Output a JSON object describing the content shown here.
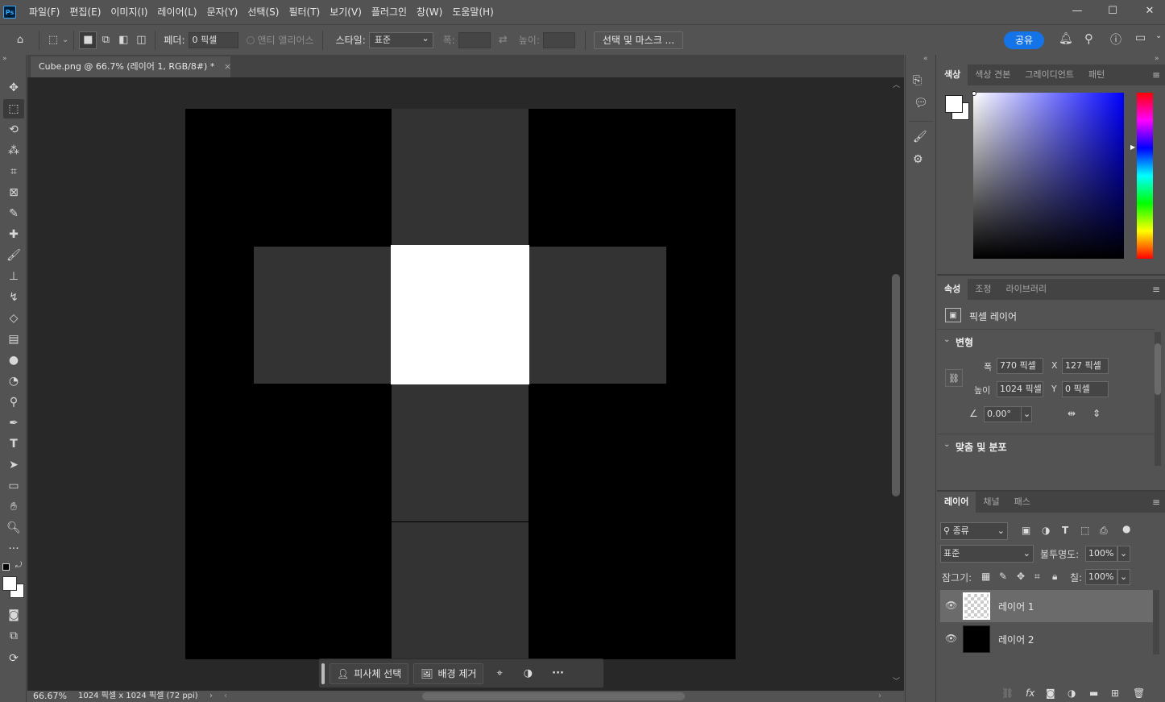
{
  "app": {
    "logo_text": "Ps",
    "menus": [
      "파일(F)",
      "편집(E)",
      "이미지(I)",
      "레이어(L)",
      "문자(Y)",
      "선택(S)",
      "필터(T)",
      "보기(V)",
      "플러그인",
      "창(W)",
      "도움말(H)"
    ],
    "window_controls": {
      "minimize": "—",
      "maximize": "☐",
      "close": "✕"
    }
  },
  "options": {
    "feather_label": "페더:",
    "feather_value": "0 픽셀",
    "antialias_label": "앤티 앨리어스",
    "style_label": "스타일:",
    "style_value": "표준",
    "width_label": "폭:",
    "height_label": "높이:",
    "select_mask_label": "선택 및 마스크 ...",
    "share_label": "공유"
  },
  "document": {
    "tab_title": "Cube.png @ 66.7% (레이어 1, RGB/8#) *",
    "tab_close": "×",
    "zoom": "66.67%",
    "info": "1024 픽셀 x 1024 픽셀 (72 ppi)"
  },
  "context_bar": {
    "select_subject": "피사체 선택",
    "remove_bg": "배경 제거",
    "more": "···"
  },
  "color_panel": {
    "tabs": [
      "색상",
      "색상 견본",
      "그레이디언트",
      "패턴"
    ],
    "hue_color": "#0000ff"
  },
  "properties_panel": {
    "tabs": [
      "속성",
      "조정",
      "라이브러리"
    ],
    "layer_type": "픽셀 레이어",
    "transform_section": "변형",
    "width_label": "폭",
    "width_value": "770 픽셀",
    "height_label": "높이",
    "height_value": "1024 픽셀",
    "x_label": "X",
    "x_value": "127 픽셀",
    "y_label": "Y",
    "y_value": "0 픽셀",
    "angle_value": "0.00°",
    "align_section": "맞춤 및 분포"
  },
  "layers_panel": {
    "tabs": [
      "레이어",
      "채널",
      "패스"
    ],
    "filter_kind": "종류",
    "blend_mode": "표준",
    "opacity_label": "불투명도:",
    "opacity_value": "100%",
    "lock_label": "잠그기:",
    "fill_label": "칠:",
    "fill_value": "100%",
    "layers": [
      {
        "name": "레이어 1",
        "selected": true
      },
      {
        "name": "레이어 2",
        "selected": false
      }
    ]
  }
}
